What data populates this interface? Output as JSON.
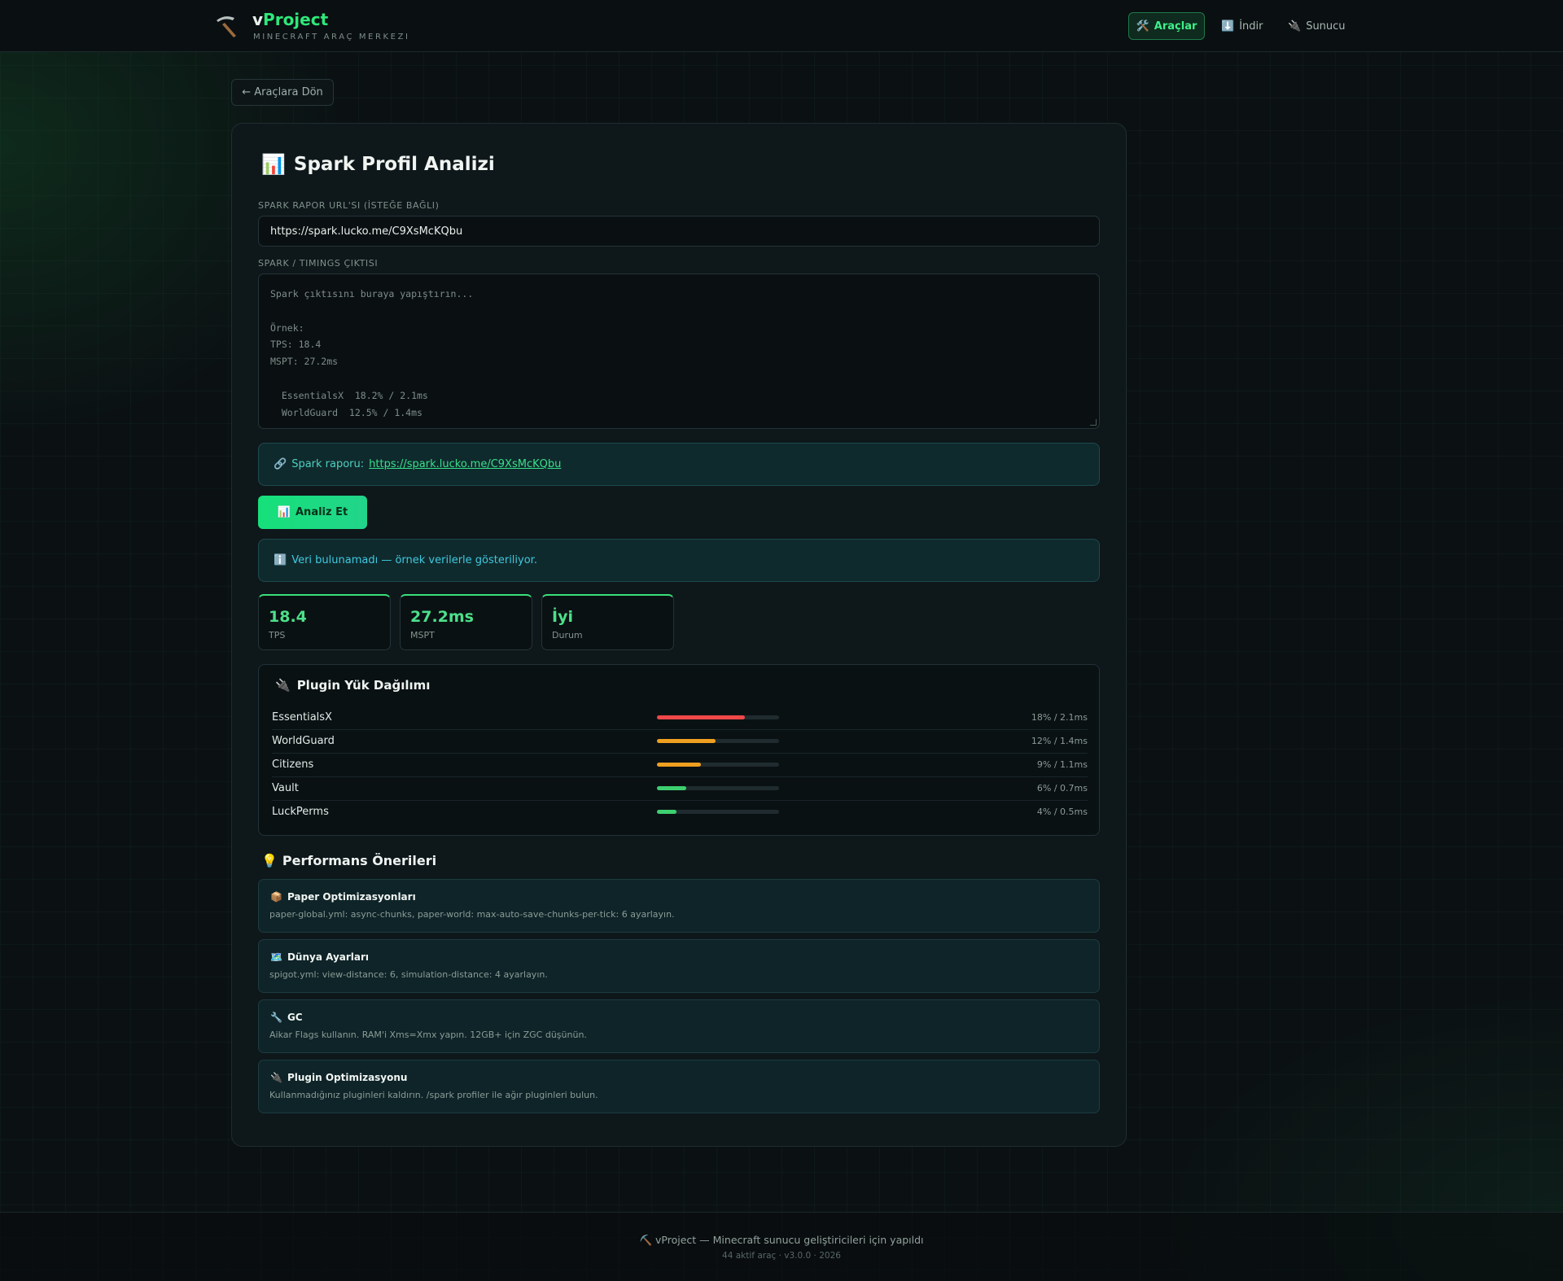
{
  "header": {
    "brand_v": "v",
    "brand_rest": "Project",
    "subtitle": "MINECRAFT ARAÇ MERKEZI",
    "nav": {
      "tools": "Araçlar",
      "download": "İndir",
      "server": "Sunucu"
    }
  },
  "back_label": "← Araçlara Dön",
  "card": {
    "title": "Spark Profil Analizi",
    "url_label": "SPARK RAPOR URL'SI (İSTEĞE BAĞLI)",
    "url_value": "https://spark.lucko.me/C9XsMcKQbu",
    "output_label": "SPARK / TIMINGS ÇIKTISI",
    "output_placeholder": "Spark çıktısını buraya yapıştırın...\n\nÖrnek:\nTPS: 18.4\nMSPT: 27.2ms\n\n  EssentialsX  18.2% / 2.1ms\n  WorldGuard  12.5% / 1.4ms",
    "report_prefix": "Spark raporu:",
    "report_link": "https://spark.lucko.me/C9XsMcKQbu",
    "analyze_label": "Analiz Et",
    "info_text": "Veri bulunamadı — örnek verilerle gösteriliyor."
  },
  "stats": [
    {
      "value": "18.4",
      "label": "TPS"
    },
    {
      "value": "27.2ms",
      "label": "MSPT"
    },
    {
      "value": "İyi",
      "label": "Durum"
    }
  ],
  "plugins": {
    "title": "Plugin Yük Dağılımı",
    "items": [
      {
        "name": "EssentialsX",
        "stat": "18% / 2.1ms",
        "percent": 72,
        "color": "#f04848"
      },
      {
        "name": "WorldGuard",
        "stat": "12% / 1.4ms",
        "percent": 48,
        "color": "#f0a020"
      },
      {
        "name": "Citizens",
        "stat": "9% / 1.1ms",
        "percent": 36,
        "color": "#f0a020"
      },
      {
        "name": "Vault",
        "stat": "6% / 0.7ms",
        "percent": 24,
        "color": "#3ed070"
      },
      {
        "name": "LuckPerms",
        "stat": "4% / 0.5ms",
        "percent": 16,
        "color": "#3ed070"
      }
    ]
  },
  "recommendations": {
    "title": "Performans Önerileri",
    "items": [
      {
        "icon": "📦",
        "title": "Paper Optimizasyonları",
        "desc": "paper-global.yml: async-chunks, paper-world: max-auto-save-chunks-per-tick: 6 ayarlayın."
      },
      {
        "icon": "🗺️",
        "title": "Dünya Ayarları",
        "desc": "spigot.yml: view-distance: 6, simulation-distance: 4 ayarlayın."
      },
      {
        "icon": "🔧",
        "title": "GC",
        "desc": "Aikar Flags kullanın. RAM'i Xms=Xmx yapın. 12GB+ için ZGC düşünün."
      },
      {
        "icon": "🔌",
        "title": "Plugin Optimizasyonu",
        "desc": "Kullanmadığınız pluginleri kaldırın. /spark profiler ile ağır pluginleri bulun."
      }
    ]
  },
  "footer": {
    "line1": "vProject — Minecraft sunucu geliştiricileri için yapıldı",
    "line2": "44 aktif araç · v3.0.0 · 2026"
  },
  "colors": {
    "accent": "#2ee87a",
    "stat_accent": "#4ce08a",
    "info": "#3fc9e0"
  }
}
